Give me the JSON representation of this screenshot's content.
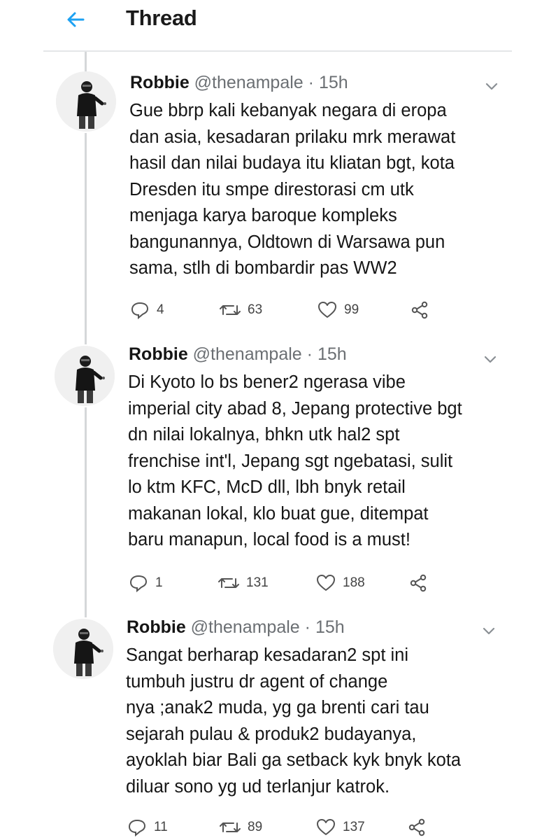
{
  "header": {
    "title": "Thread"
  },
  "tweets": [
    {
      "name": "Robbie",
      "handle": "@thenampale",
      "separator": "·",
      "time": "15h",
      "lines": [
        "Gue bbrp kali kebanyak negara di eropa",
        "dan asia, kesadaran prilaku mrk merawat",
        "hasil dan nilai budaya itu kliatan bgt, kota",
        "Dresden itu smpe direstorasi cm utk",
        "menjaga karya baroque kompleks",
        "bangunannya, Oldtown di Warsawa pun",
        "sama, stlh di bombardir pas WW2"
      ],
      "replies": "4",
      "retweets": "63",
      "likes": "99"
    },
    {
      "name": "Robbie",
      "handle": "@thenampale",
      "separator": "·",
      "time": "15h",
      "lines": [
        "Di Kyoto lo bs bener2 ngerasa vibe",
        "imperial city abad 8, Jepang protective bgt",
        "dn nilai lokalnya, bhkn utk hal2 spt",
        "frenchise int'l, Jepang sgt ngebatasi, sulit",
        "lo ktm KFC, McD dll, lbh bnyk retail",
        "makanan lokal, klo buat gue, ditempat",
        "baru manapun, local food is a must!"
      ],
      "replies": "1",
      "retweets": "131",
      "likes": "188"
    },
    {
      "name": "Robbie",
      "handle": "@thenampale",
      "separator": "·",
      "time": "15h",
      "lines": [
        "Sangat berharap kesadaran2 spt ini",
        "tumbuh justru dr agent of change",
        "nya ;anak2 muda, yg ga brenti cari tau",
        "sejarah pulau & produk2 budayanya,",
        "ayoklah biar Bali ga setback kyk bnyk kota",
        "diluar sono yg ud terlanjur katrok."
      ],
      "replies": "11",
      "retweets": "89",
      "likes": "137"
    }
  ],
  "colors": {
    "accent": "#1da1f2",
    "text": "#161616",
    "muted": "#6b6f73",
    "divider": "#e4e6e8"
  },
  "icons": {
    "back": "arrow-left-icon",
    "menu": "chevron-down-icon",
    "reply": "reply-icon",
    "retweet": "retweet-icon",
    "like": "heart-icon",
    "share": "share-icon"
  }
}
